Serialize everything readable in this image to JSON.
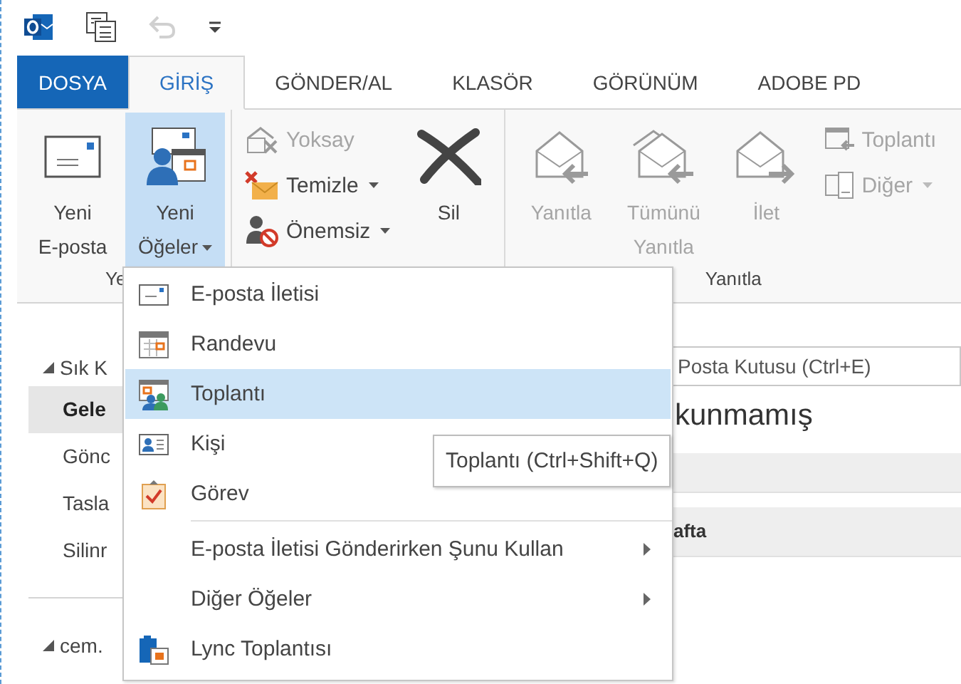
{
  "quick_access": [
    {
      "kind": "app",
      "disabled": false
    },
    {
      "kind": "send-receive",
      "disabled": false
    },
    {
      "kind": "undo",
      "disabled": true
    },
    {
      "kind": "customize",
      "disabled": false
    }
  ],
  "tabs": [
    {
      "label": "DOSYA",
      "kind": "file",
      "selected": false
    },
    {
      "label": "GİRİŞ",
      "kind": "tab",
      "selected": true
    },
    {
      "label": "GÖNDER/AL",
      "kind": "tab",
      "selected": false
    },
    {
      "label": "KLASÖR",
      "kind": "tab",
      "selected": false
    },
    {
      "label": "GÖRÜNÜM",
      "kind": "tab",
      "selected": false
    },
    {
      "label": "ADOBE PD",
      "kind": "tab",
      "selected": false
    }
  ],
  "ribbon": {
    "groups": [
      {
        "label": "Ye",
        "items": [
          {
            "kind": "large",
            "label": "Yeni E-posta",
            "disabled": false,
            "pressed": false,
            "dropdown": false
          },
          {
            "kind": "large",
            "label": "Yeni Öğeler",
            "disabled": false,
            "pressed": true,
            "dropdown": true
          }
        ]
      },
      {
        "items": [
          {
            "kind": "stack",
            "items": [
              {
                "label": "Yoksay",
                "disabled": true,
                "dropdown": false
              },
              {
                "label": "Temizle",
                "disabled": false,
                "dropdown": true
              },
              {
                "label": "Önemsiz",
                "disabled": false,
                "dropdown": true
              }
            ]
          },
          {
            "kind": "large",
            "label": "Sil",
            "disabled": false,
            "pressed": false,
            "dropdown": false
          }
        ]
      },
      {
        "label": "Yanıtla",
        "items": [
          {
            "kind": "large",
            "label": "Yanıtla",
            "disabled": true,
            "pressed": false,
            "dropdown": false
          },
          {
            "kind": "large",
            "label": "Tümünü Yanıtla",
            "disabled": true,
            "pressed": false,
            "dropdown": false
          },
          {
            "kind": "large",
            "label": "İlet",
            "disabled": true,
            "pressed": false,
            "dropdown": false
          },
          {
            "kind": "stack",
            "items": [
              {
                "label": "Toplantı",
                "disabled": true,
                "dropdown": false
              },
              {
                "label": "Diğer",
                "disabled": true,
                "dropdown": true
              }
            ]
          }
        ]
      }
    ]
  },
  "nav": {
    "sections": [
      {
        "label": "Sık K",
        "expanded": true,
        "children": [
          {
            "label": "Gele",
            "selected": true
          },
          {
            "label": "Gönc",
            "selected": false
          },
          {
            "label": "Tasla",
            "selected": false
          },
          {
            "label": "Silinr",
            "selected": false
          }
        ]
      },
      {
        "label": "cem.",
        "expanded": true
      }
    ]
  },
  "mail_pane": {
    "search": {
      "placeholder": "Posta Kutusu (Ctrl+E)"
    },
    "heading": "kunmamış",
    "groups": [
      {
        "label": "afta"
      }
    ]
  },
  "menu": {
    "items": [
      {
        "kind": "item",
        "label": "E-posta İletisi",
        "highlighted": false
      },
      {
        "kind": "item",
        "label": "Randevu",
        "highlighted": false
      },
      {
        "kind": "item",
        "label": "Toplantı",
        "highlighted": true
      },
      {
        "kind": "item",
        "label": "Kişi",
        "highlighted": false
      },
      {
        "kind": "item",
        "label": "Görev",
        "highlighted": false
      },
      {
        "kind": "separator"
      },
      {
        "kind": "item",
        "label": "E-posta İletisi Gönderirken Şunu Kullan",
        "highlighted": false,
        "submenu": true
      },
      {
        "kind": "item",
        "label": "Diğer Öğeler",
        "highlighted": false,
        "submenu": true
      },
      {
        "kind": "item",
        "label": "Lync Toplantısı",
        "highlighted": false
      }
    ]
  },
  "tooltip": {
    "text": "Toplantı (Ctrl+Shift+Q)"
  }
}
